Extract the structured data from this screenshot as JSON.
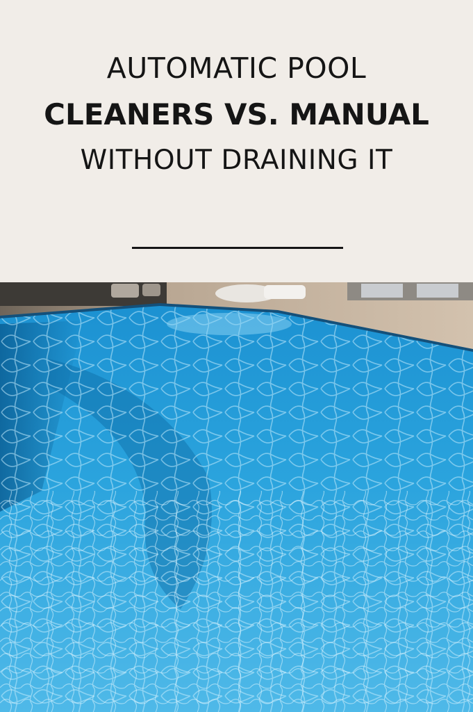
{
  "header": {
    "line1": "AUTOMATIC POOL",
    "line2": "CLEANERS VS. MANUAL",
    "line3": "WITHOUT DRAINING IT"
  },
  "photo": {
    "subject": "swimming pool with clear blue water and caustic light ripples",
    "colors": {
      "water_deep": "#0f78b5",
      "water_mid": "#1f9bd6",
      "water_light": "#5ec4ee",
      "deck": "#c9b7a2",
      "background": "#f1ede8"
    }
  }
}
